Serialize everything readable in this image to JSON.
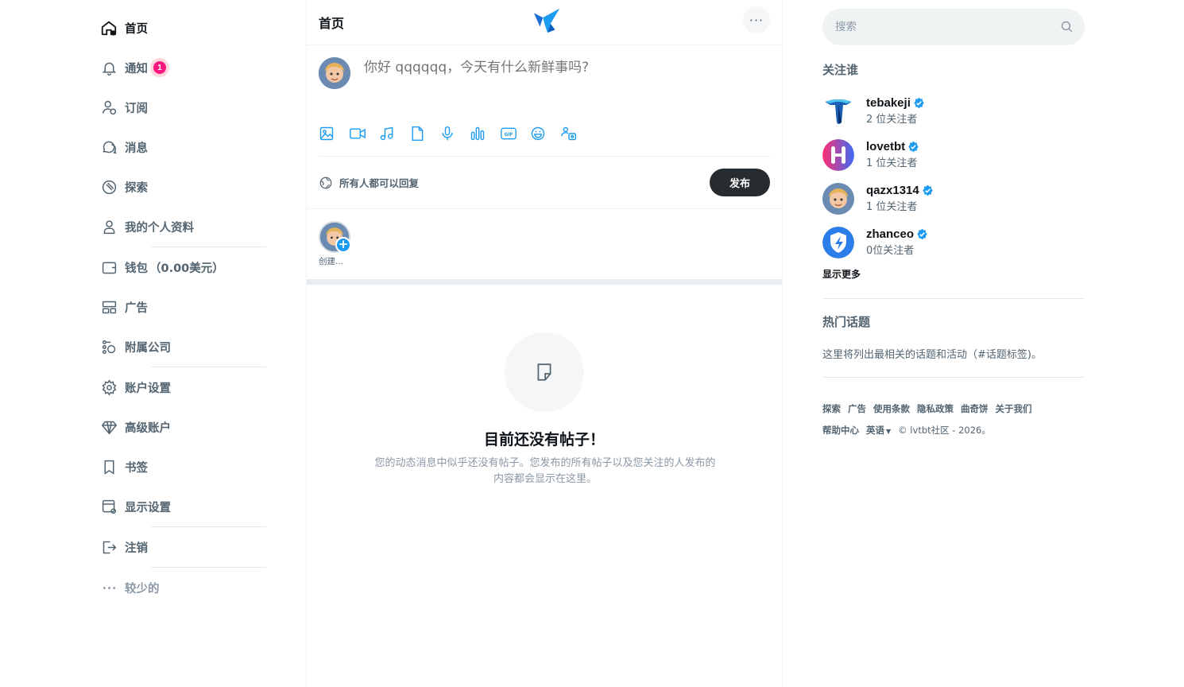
{
  "nav": {
    "items": [
      {
        "label": "首页",
        "icon": "home-icon",
        "active": true
      },
      {
        "label": "通知",
        "icon": "bell-icon",
        "badge": "1"
      },
      {
        "label": "订阅",
        "icon": "subscriptions-icon"
      },
      {
        "label": "消息",
        "icon": "messages-icon"
      },
      {
        "label": "探索",
        "icon": "explore-icon"
      },
      {
        "label": "我的个人资料",
        "icon": "profile-icon"
      },
      {
        "label": "钱包",
        "icon": "wallet-icon",
        "amount": "（0.00美元）"
      },
      {
        "label": "广告",
        "icon": "ads-icon"
      },
      {
        "label": "附属公司",
        "icon": "affiliates-icon"
      },
      {
        "label": "账户设置",
        "icon": "settings-icon"
      },
      {
        "label": "高级账户",
        "icon": "diamond-icon"
      },
      {
        "label": "书签",
        "icon": "bookmark-icon"
      },
      {
        "label": "显示设置",
        "icon": "display-settings-icon"
      },
      {
        "label": "注销",
        "icon": "logout-icon"
      },
      {
        "label": "较少的",
        "icon": "more-dots-icon"
      }
    ]
  },
  "header": {
    "title": "首页",
    "more": "···"
  },
  "composer": {
    "placeholder": "你好 qqqqqq，今天有什么新鲜事吗?",
    "reply_setting": "所有人都可以回复",
    "post_label": "发布"
  },
  "stories": {
    "create_label": "创建..."
  },
  "empty_state": {
    "title": "目前还没有帖子！",
    "description": "您的动态消息中似乎还没有帖子。您发布的所有帖子以及您关注的人发布的内容都会显示在这里。"
  },
  "sidebar": {
    "search_placeholder": "搜索",
    "who_to_follow_title": "关注谁",
    "users": [
      {
        "name": "tebakeji",
        "followers": "2 位关注者"
      },
      {
        "name": "lovetbt",
        "followers": "1 位关注者"
      },
      {
        "name": "qazx1314",
        "followers": "1 位关注者"
      },
      {
        "name": "zhanceo",
        "followers": "0位关注者"
      }
    ],
    "show_more": "显示更多",
    "trending_title": "热门话题",
    "trending_desc": "这里将列出最相关的话题和活动（#话题标签)。",
    "footer": {
      "links": [
        "探索",
        "广告",
        "使用条款",
        "隐私政策",
        "曲奇饼",
        "关于我们"
      ],
      "help": "帮助中心",
      "language": "英语",
      "copyright": "© lvtbt社区 - 2026。"
    }
  },
  "colors": {
    "accent": "#1d9bf0",
    "badge": "#f91880",
    "wallet": "#1a9b3a",
    "post_button": "#272c30"
  }
}
